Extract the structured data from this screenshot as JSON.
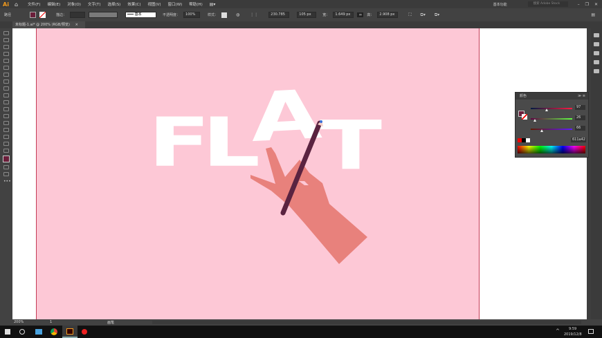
{
  "app": {
    "logo": "Ai",
    "home_icon": "home-icon"
  },
  "menu": [
    "文件(F)",
    "编辑(E)",
    "对象(O)",
    "文字(T)",
    "选择(S)",
    "效果(C)",
    "视图(V)",
    "窗口(W)",
    "帮助(H)"
  ],
  "workspace": "基本功能",
  "search_placeholder": "搜索 Adobe Stock",
  "control": {
    "object_type": "路径",
    "fill_color": "#6b1e3a",
    "stroke_label": "描边：",
    "brush_label": "基本",
    "opacity_label": "不透明度：",
    "opacity": "100%",
    "style_label": "样式：",
    "x": "230.785",
    "y": "105 px",
    "w_label": "宽：",
    "w": "1.649 px",
    "h_label": "高：",
    "h": "2.908 px"
  },
  "tab": {
    "title": "未标题-1.ai* @ 200% (RGB/预览)",
    "close": "×"
  },
  "artwork": {
    "letters": [
      "F",
      "L",
      "A",
      "T"
    ],
    "bg": "#fdc8d6",
    "hand": "#e8817c",
    "pencil": "#5a2340"
  },
  "color_panel": {
    "title": "颜色",
    "r": "97",
    "g": "26",
    "b": "66",
    "hex": "611a42",
    "r_frac": 0.38,
    "g_frac": 0.1,
    "b_frac": 0.26
  },
  "status": {
    "zoom": "200%",
    "page": "1",
    "tool": "画笔"
  },
  "taskbar": {
    "time": "9:59",
    "date": "2019/12/8"
  }
}
